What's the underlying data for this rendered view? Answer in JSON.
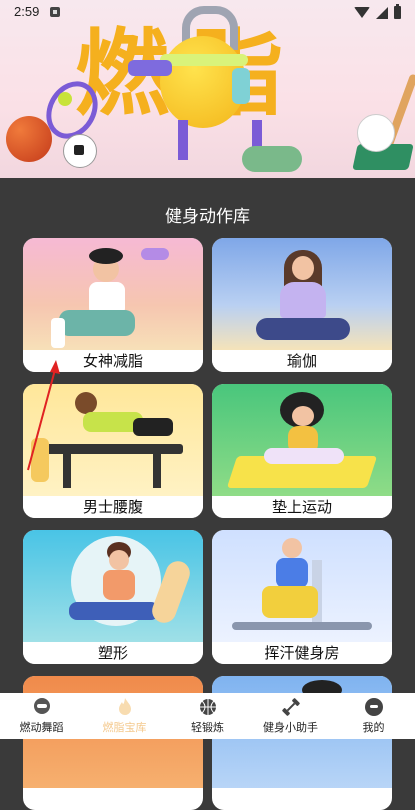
{
  "status": {
    "time": "2:59"
  },
  "banner": {
    "title": "燃脂"
  },
  "section": {
    "title": "健身动作库"
  },
  "cards": [
    {
      "label": "女神减脂"
    },
    {
      "label": "瑜伽"
    },
    {
      "label": "男士腰腹"
    },
    {
      "label": "垫上运动"
    },
    {
      "label": "塑形"
    },
    {
      "label": "挥汗健身房"
    }
  ],
  "nav": [
    {
      "label": "燃动舞蹈",
      "icon": "dance-icon",
      "active": false
    },
    {
      "label": "燃脂宝库",
      "icon": "flame-icon",
      "active": true
    },
    {
      "label": "轻锻炼",
      "icon": "basketball-icon",
      "active": false
    },
    {
      "label": "健身小助手",
      "icon": "dumbbell-icon",
      "active": false
    },
    {
      "label": "我的",
      "icon": "profile-icon",
      "active": false
    }
  ],
  "colors": {
    "accent": "#f5b01e",
    "active_tab": "#f4c98e",
    "background": "#3a3a3a"
  }
}
